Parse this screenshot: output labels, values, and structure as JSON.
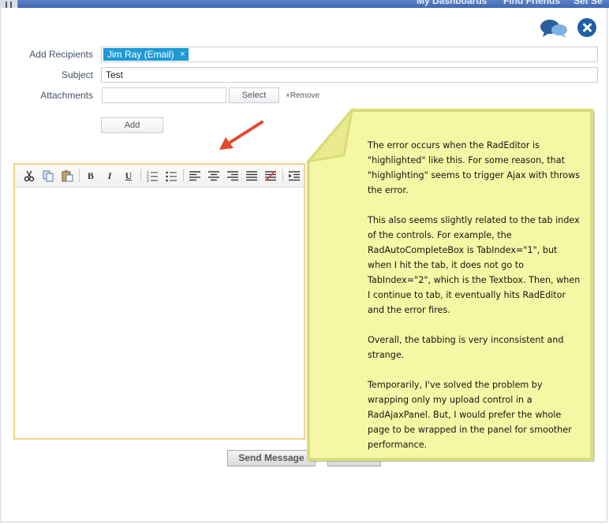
{
  "header": {
    "nav_items": [
      "My Dashboards",
      "Find Friends",
      "Set Se"
    ]
  },
  "icons": {
    "chat": "chat-bubbles-icon",
    "close": "close-circle-icon"
  },
  "form": {
    "recipients_label": "Add Recipients",
    "recipient_token": "Jim Ray (Email)",
    "token_remove_glyph": "×",
    "subject_label": "Subject",
    "subject_value": "Test",
    "attachments_label": "Attachments",
    "select_button": "Select",
    "remove_link": "×Remove",
    "add_button": "Add"
  },
  "editor": {
    "toolbar": [
      "cut",
      "copy",
      "paste",
      "bold",
      "italic",
      "underline",
      "numbered-list",
      "bulleted-list",
      "align-left",
      "align-center",
      "align-right",
      "justify",
      "strikethrough",
      "indent"
    ],
    "bold_glyph": "B",
    "italic_glyph": "I",
    "underline_glyph": "U"
  },
  "actions": {
    "send_message": "Send Message"
  },
  "note": {
    "paragraphs": [
      "The error occurs when the RadEditor is \"highlighted\" like this.  For some reason, that \"highlighting\" seems to trigger Ajax with throws the error.",
      "This also seems slightly related to the tab index of the controls.  For example, the RadAutoCompleteBox is TabIndex=\"1\", but when I hit the tab, it does not go to TabIndex=\"2\", which is the Textbox.  Then, when I continue to tab, it eventually hits RadEditor and the error fires.",
      "Overall, the tabbing is very inconsistent and strange.",
      "Temporarily, I've solved the problem by wrapping only my upload control in a RadAjaxPanel.  But, I would prefer the whole page to be wrapped in the panel for smoother performance."
    ]
  },
  "colors": {
    "token_bg": "#1e9ad6",
    "note_bg": "#f6f7a5",
    "note_border": "#d9dc7a",
    "editor_border": "#f2d38a",
    "arrow": "#e2492b",
    "close_icon": "#1f5fa8"
  }
}
